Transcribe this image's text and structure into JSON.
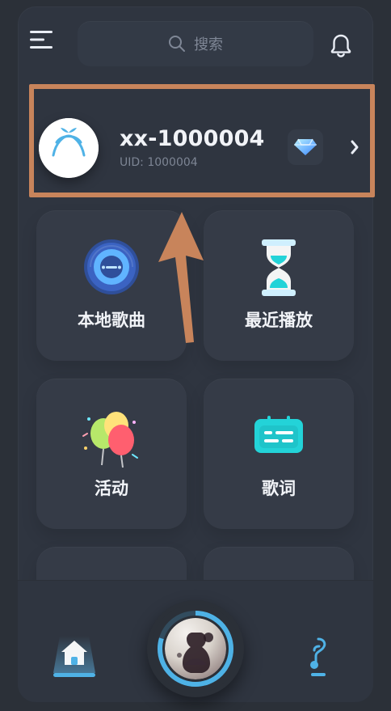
{
  "header": {
    "search_placeholder": "搜索"
  },
  "profile": {
    "username": "xx-1000004",
    "uid_label": "UID: 1000004"
  },
  "tiles": [
    {
      "label": "本地歌曲"
    },
    {
      "label": "最近播放"
    },
    {
      "label": "活动"
    },
    {
      "label": "歌词"
    }
  ],
  "colors": {
    "background": "#2b3038",
    "tile": "#353b47",
    "highlight": "#c8845b",
    "accent_blue": "#4fb2e6"
  },
  "icons": {
    "menu": "menu-icon",
    "search": "search-icon",
    "bell": "bell-icon",
    "vip": "diamond-icon",
    "chevron": "chevron-right-icon",
    "local_music": "vinyl-icon",
    "recent": "hourglass-icon",
    "activity": "balloons-icon",
    "lyrics": "lyrics-icon",
    "home": "home-icon",
    "music": "music-note-icon"
  }
}
